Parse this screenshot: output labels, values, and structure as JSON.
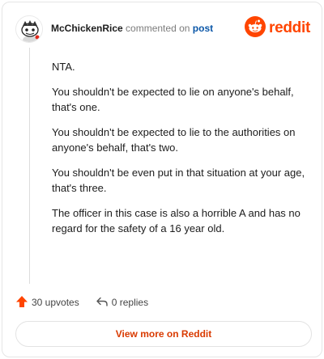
{
  "header": {
    "username": "McChickenRice",
    "action_text": "commented on",
    "post_link": "post",
    "brand_name": "reddit",
    "avatar_icon": "snoo-avatar-icon",
    "brand_icon": "reddit-logo-icon"
  },
  "comment": {
    "paragraphs": [
      "NTA.",
      "You shouldn't be expected to lie on anyone's behalf, that's one.",
      "You shouldn't be expected to lie to the authorities on anyone's behalf, that's two.",
      "You shouldn't be even put in that situation at your age, that's three.",
      "The officer in this case is also a horrible A and has no regard for the safety of a 16 year old."
    ]
  },
  "actions": {
    "upvotes_label": "30 upvotes",
    "replies_label": "0 replies",
    "upvote_icon": "upvote-arrow-icon",
    "reply_icon": "reply-arrow-icon"
  },
  "footer": {
    "view_more_label": "View more on Reddit"
  },
  "colors": {
    "brand": "#ff4500",
    "link": "#0b57a8",
    "view_more_text": "#d93a00"
  }
}
